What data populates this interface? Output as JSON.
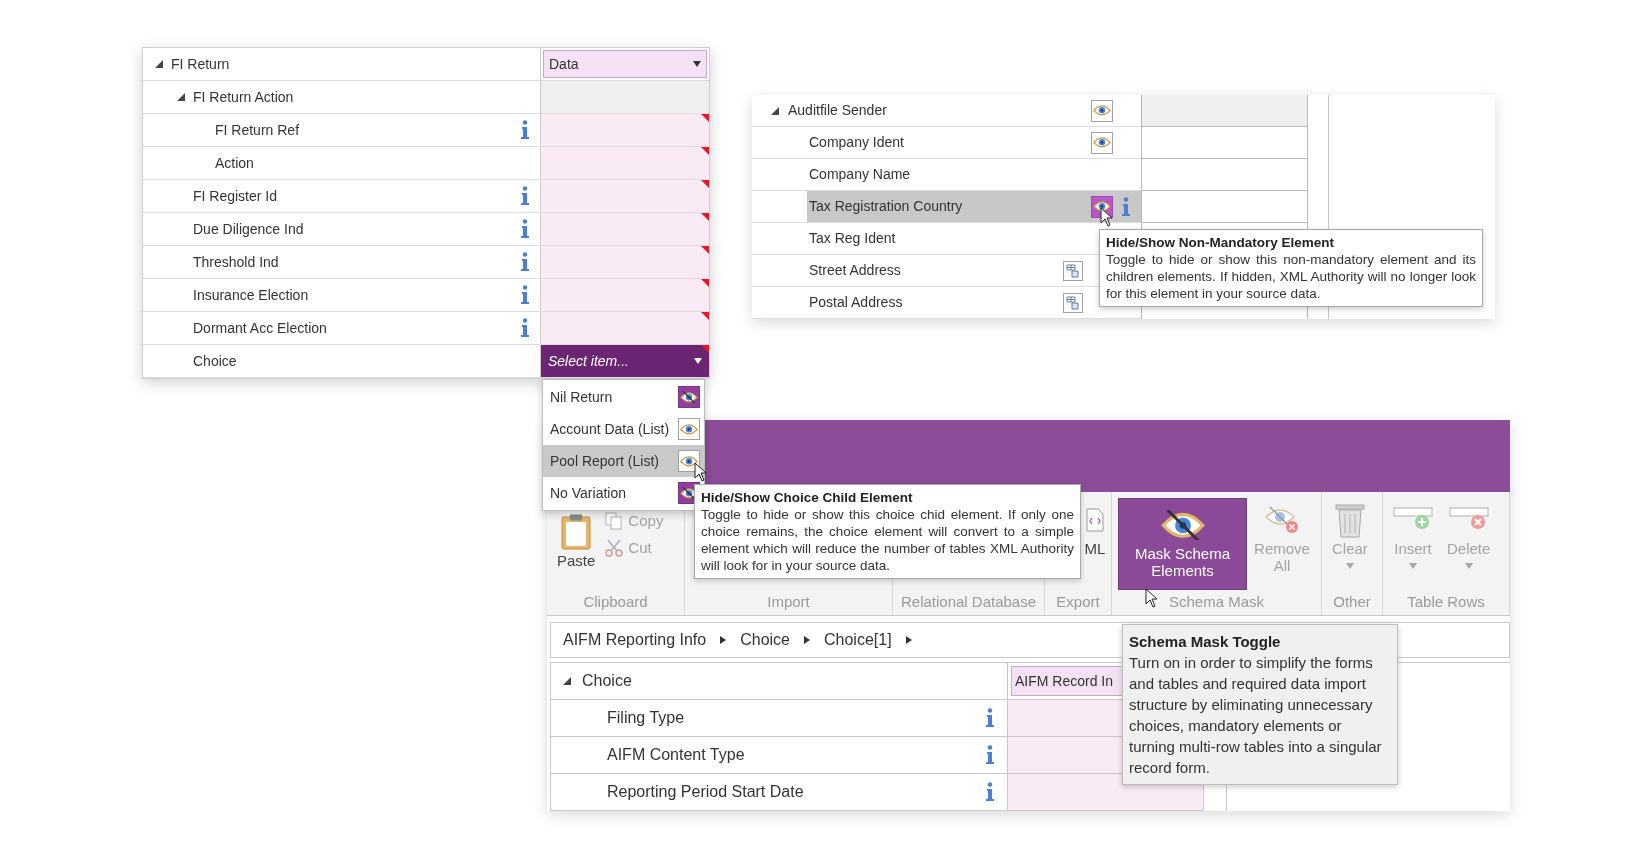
{
  "fi_tree": {
    "label": "FI Return",
    "expanded": true,
    "value": "Data",
    "required": false,
    "info": false,
    "children": [
      {
        "label": "FI Return Action",
        "expanded": true,
        "required": false,
        "info": false,
        "children": [
          {
            "label": "FI Return Ref",
            "info": true,
            "required": true
          },
          {
            "label": "Action",
            "info": false,
            "required": true
          }
        ]
      },
      {
        "label": "FI Register Id",
        "info": true,
        "required": true
      },
      {
        "label": "Due Diligence Ind",
        "info": true,
        "required": true
      },
      {
        "label": "Threshold Ind",
        "info": true,
        "required": true
      },
      {
        "label": "Insurance Election",
        "info": true,
        "required": true
      },
      {
        "label": "Dormant Acc Election",
        "info": true,
        "required": true
      },
      {
        "label": "Choice",
        "info": false,
        "required": true,
        "placeholder": "Select item..."
      }
    ]
  },
  "choice_menu": [
    {
      "label": "Nil Return",
      "masked": true,
      "selected": false
    },
    {
      "label": "Account Data (List)",
      "masked": false,
      "selected": false
    },
    {
      "label": "Pool Report (List)",
      "masked": false,
      "selected": true
    },
    {
      "label": "No Variation",
      "masked": true,
      "selected": false
    }
  ],
  "choice_tooltip": {
    "title": "Hide/Show Choice Child Element",
    "text": "Toggle to hide or show this choice chid element.  If only one choice remains, the choice element will convert to a simple element which will reduce the number of tables XML Authority will look for in your source data."
  },
  "sender_tree": {
    "label": "Auditfile Sender",
    "expanded": true,
    "mask_toggle": true,
    "masked": false,
    "selected": false,
    "children": [
      {
        "label": "Company Ident",
        "mask_toggle": true,
        "masked": false,
        "selected": false
      },
      {
        "label": "Company Name",
        "mask_toggle": false,
        "selected": false
      },
      {
        "label": "Tax Registration Country",
        "mask_toggle": true,
        "masked": false,
        "info": true,
        "selected": true
      },
      {
        "label": "Tax Reg Ident",
        "mask_toggle": false,
        "selected": false
      },
      {
        "label": "Street Address",
        "mask_toggle": false,
        "table_link": true,
        "selected": false
      },
      {
        "label": "Postal Address",
        "mask_toggle": false,
        "table_link": true,
        "selected": false
      }
    ]
  },
  "sender_tooltip": {
    "title": "Hide/Show Non-Mandatory Element",
    "text": "Toggle to hide or show this non-mandatory element and its children elements.  If hidden, XML Authority will no longer look for this element in your source data."
  },
  "ribbon": {
    "groups": [
      {
        "label": "Clipboard",
        "buttons": [
          {
            "label": "Paste",
            "kind": "large",
            "disabled": false,
            "selected": false
          },
          {
            "label": "Copy",
            "kind": "small",
            "disabled": true,
            "selected": false
          },
          {
            "label": "Cut",
            "kind": "small",
            "disabled": true,
            "selected": false
          }
        ]
      },
      {
        "label": "Import"
      },
      {
        "label": "Relational Database"
      },
      {
        "label": "Export",
        "buttons": [
          {
            "label": "ML",
            "kind": "large",
            "disabled": false,
            "selected": false
          }
        ]
      },
      {
        "label": "Schema Mask",
        "buttons": [
          {
            "label": "Mask Schema Elements",
            "kind": "large",
            "disabled": false,
            "selected": true
          },
          {
            "label": "Remove All",
            "kind": "large",
            "disabled": true,
            "selected": false
          }
        ]
      },
      {
        "label": "Other",
        "buttons": [
          {
            "label": "Clear",
            "kind": "menu",
            "disabled": true,
            "selected": false
          }
        ]
      },
      {
        "label": "Table Rows",
        "buttons": [
          {
            "label": "Insert",
            "kind": "menu",
            "disabled": true,
            "selected": false
          },
          {
            "label": "Delete",
            "kind": "menu",
            "disabled": true,
            "selected": false
          }
        ]
      }
    ]
  },
  "breadcrumb": [
    "AIFM Reporting Info",
    "Choice",
    "Choice[1]"
  ],
  "form_tree": {
    "label": "Choice",
    "expanded": true,
    "value": "AIFM Record In",
    "children": [
      {
        "label": "Filing Type",
        "info": true
      },
      {
        "label": "AIFM Content Type",
        "info": true
      },
      {
        "label": "Reporting Period Start Date",
        "info": true
      }
    ]
  },
  "schema_tooltip": {
    "title": "Schema Mask Toggle",
    "text": "Turn on in order to simplify the forms and tables and required data import structure by eliminating unnecessary choices, mandatory elements or turning multi-row tables into a singular record form."
  }
}
